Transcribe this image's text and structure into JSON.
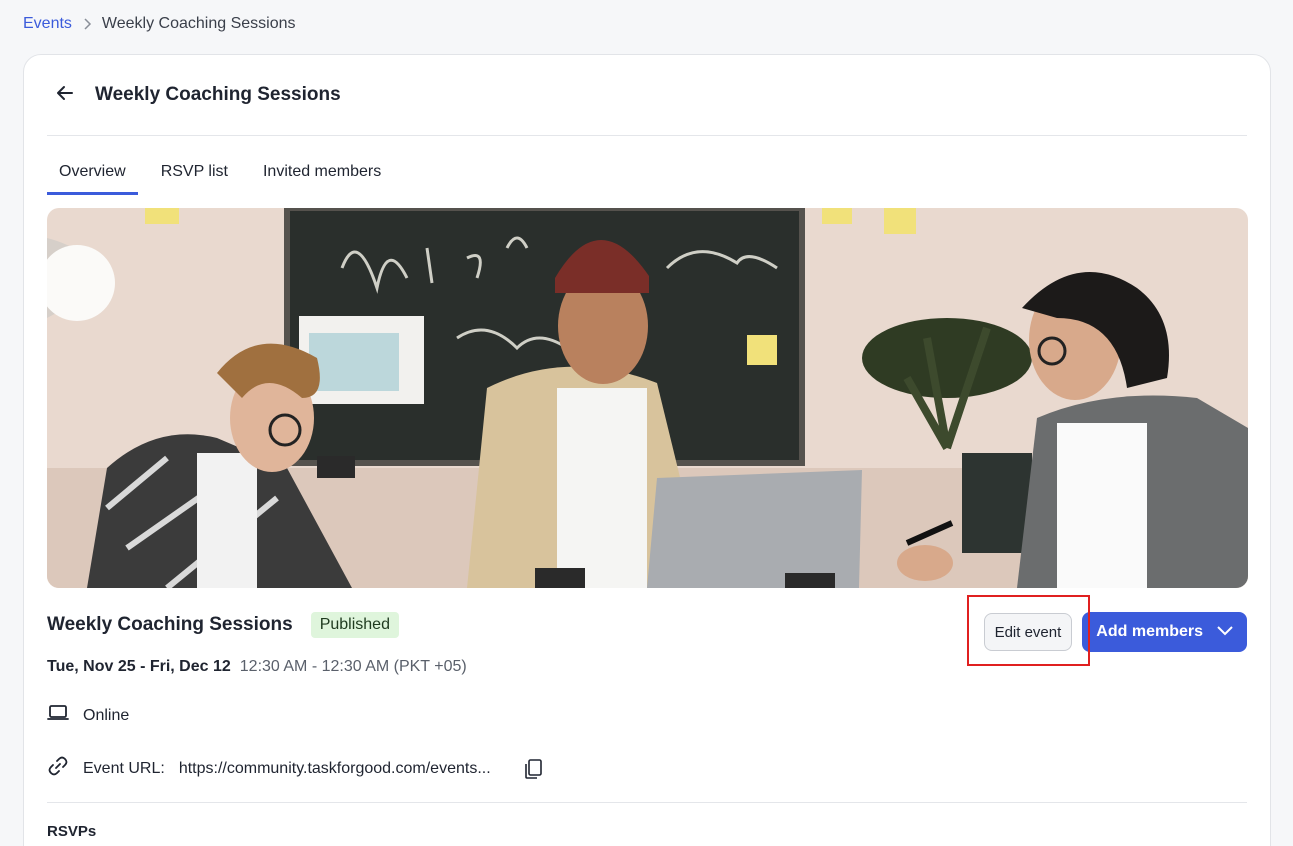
{
  "breadcrumb": {
    "root": "Events",
    "current": "Weekly Coaching Sessions"
  },
  "header": {
    "title": "Weekly Coaching Sessions"
  },
  "tabs": [
    {
      "label": "Overview",
      "active": true
    },
    {
      "label": "RSVP list",
      "active": false
    },
    {
      "label": "Invited members",
      "active": false
    }
  ],
  "event": {
    "title": "Weekly Coaching Sessions",
    "status": "Published",
    "date_range": "Tue, Nov 25 - Fri, Dec 12",
    "time_range": "12:30 AM - 12:30 AM (PKT +05)",
    "location": "Online",
    "url_label": "Event URL:",
    "url_value": "https://community.taskforgood.com/events..."
  },
  "actions": {
    "edit_label": "Edit event",
    "add_members_label": "Add members"
  },
  "sections": {
    "rsvps_heading": "RSVPs"
  },
  "colors": {
    "accent": "#3b5bdb",
    "badge_bg": "#dff5dc",
    "highlight": "#e02020"
  },
  "icons": {
    "back": "arrow-left-icon",
    "breadcrumb_sep": "chevron-right-icon",
    "add_members_caret": "chevron-down-icon",
    "online": "laptop-icon",
    "url": "link-icon",
    "copy": "copy-icon"
  }
}
